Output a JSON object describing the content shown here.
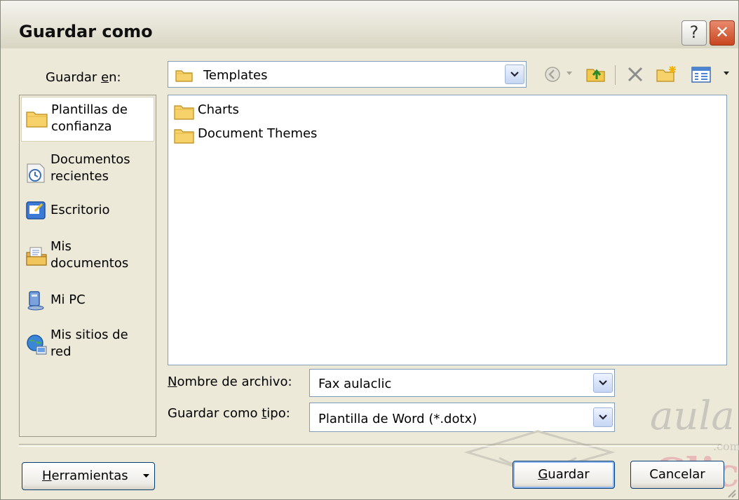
{
  "window": {
    "title": "Guardar como",
    "help_label": "?",
    "close_label": "✕"
  },
  "save_in": {
    "label_pre": "Guardar ",
    "label_key": "e",
    "label_post": "n:",
    "value": "Templates"
  },
  "places": [
    {
      "label": "Plantillas de\nconfianza",
      "icon": "trusted-templates-folder-icon",
      "selected": true
    },
    {
      "label": "Documentos\nrecientes",
      "icon": "recent-documents-icon"
    },
    {
      "label": "Escritorio",
      "icon": "desktop-icon"
    },
    {
      "label": "Mis\ndocumentos",
      "icon": "my-documents-icon"
    },
    {
      "label": "Mi PC",
      "icon": "my-computer-icon"
    },
    {
      "label": "Mis sitios de\nred",
      "icon": "network-places-icon"
    }
  ],
  "files": [
    {
      "name": "Charts",
      "icon": "folder-icon"
    },
    {
      "name": "Document Themes",
      "icon": "folder-icon"
    }
  ],
  "filename": {
    "label_key": "N",
    "label_rest": "ombre de archivo:",
    "value": "Fax aulaclic"
  },
  "filetype": {
    "label_pre": "Guardar como ",
    "label_key": "t",
    "label_post": "ipo:",
    "value": "Plantilla de Word (*.dotx)"
  },
  "buttons": {
    "tools_key": "H",
    "tools_rest": "erramientas",
    "save_key": "G",
    "save_rest": "uardar",
    "cancel": "Cancelar"
  },
  "watermark": {
    "line1": "aula",
    "line2": "Clic",
    "line3": ".com"
  }
}
